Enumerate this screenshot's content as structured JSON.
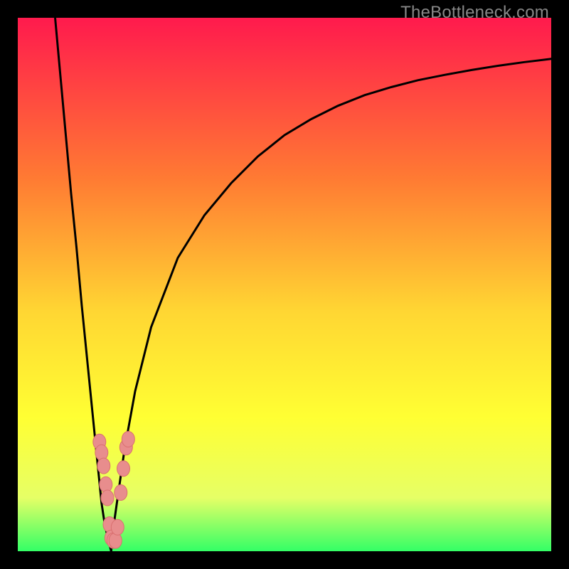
{
  "watermark": "TheBottleneck.com",
  "colors": {
    "bg_black": "#000000",
    "grad_top": "#ff1a4d",
    "grad_mid1": "#ff7a33",
    "grad_mid2": "#ffd633",
    "grad_mid3": "#ffff33",
    "grad_low": "#e6ff66",
    "grad_green": "#33ff66",
    "curve": "#000000",
    "marker_fill": "#e88d8d",
    "marker_stroke": "#d97070"
  },
  "chart_data": {
    "type": "line",
    "title": "",
    "xlabel": "",
    "ylabel": "",
    "xlim": [
      0,
      100
    ],
    "ylim": [
      0,
      100
    ],
    "grid": false,
    "legend": false,
    "series": [
      {
        "name": "left_branch",
        "x": [
          7,
          8,
          9,
          10,
          11,
          12,
          13,
          14,
          15,
          15.7,
          16.3,
          17,
          17.5
        ],
        "y": [
          100,
          89,
          78,
          67,
          57,
          46,
          36,
          26,
          16,
          9,
          5,
          2,
          0
        ]
      },
      {
        "name": "right_branch",
        "x": [
          17.5,
          18,
          19,
          20,
          22,
          25,
          30,
          35,
          40,
          45,
          50,
          55,
          60,
          65,
          70,
          75,
          80,
          85,
          90,
          95,
          100
        ],
        "y": [
          0,
          5,
          12,
          19,
          30,
          42,
          55,
          63,
          69,
          74,
          78,
          81,
          83.5,
          85.5,
          87,
          88.3,
          89.3,
          90.2,
          91,
          91.7,
          92.3
        ]
      }
    ],
    "markers": [
      {
        "x": 15.3,
        "y": 20.5
      },
      {
        "x": 15.7,
        "y": 18.5
      },
      {
        "x": 16.1,
        "y": 16.0
      },
      {
        "x": 16.5,
        "y": 12.5
      },
      {
        "x": 16.8,
        "y": 10.0
      },
      {
        "x": 17.2,
        "y": 5.0
      },
      {
        "x": 17.5,
        "y": 2.5
      },
      {
        "x": 17.9,
        "y": 2.0
      },
      {
        "x": 18.3,
        "y": 2.0
      },
      {
        "x": 18.7,
        "y": 4.5
      },
      {
        "x": 19.3,
        "y": 11.0
      },
      {
        "x": 19.8,
        "y": 15.5
      },
      {
        "x": 20.3,
        "y": 19.5
      },
      {
        "x": 20.7,
        "y": 21.0
      }
    ],
    "vertex_x": 17.5
  }
}
